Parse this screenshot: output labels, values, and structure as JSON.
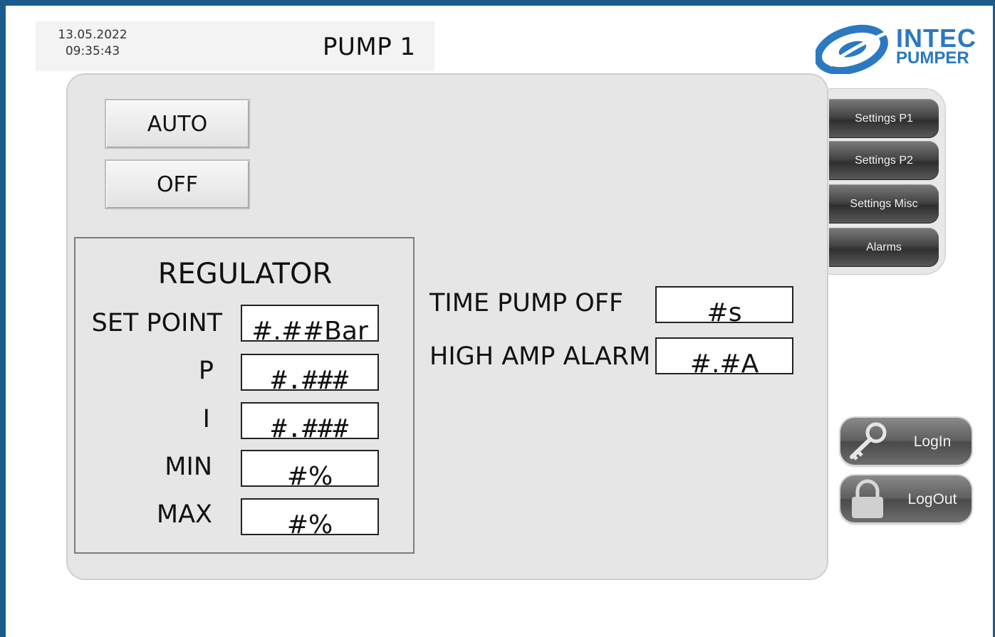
{
  "header": {
    "date": "13.05.2022",
    "time": "09:35:43",
    "title": "PUMP 1",
    "logo_line1": "INTEC",
    "logo_line2": "PUMPER",
    "brand_color": "#2b79c2"
  },
  "mode_buttons": {
    "auto": "AUTO",
    "off": "OFF"
  },
  "regulator": {
    "title": "REGULATOR",
    "rows": [
      {
        "label": "SET POINT",
        "value": "#.##Bar"
      },
      {
        "label": "P",
        "value": "#.###"
      },
      {
        "label": "I",
        "value": "#.###"
      },
      {
        "label": "MIN",
        "value": "#%"
      },
      {
        "label": "MAX",
        "value": "#%"
      }
    ]
  },
  "settings": {
    "time_pump_off": {
      "label": "TIME PUMP OFF",
      "value": "#s"
    },
    "high_amp_alarm": {
      "label": "HIGH AMP ALARM",
      "value": "#.#A"
    }
  },
  "nav": {
    "items": [
      {
        "label": "Settings P1"
      },
      {
        "label": "Settings P2"
      },
      {
        "label": "Settings Misc"
      },
      {
        "label": "Alarms"
      }
    ]
  },
  "auth": {
    "login": "LogIn",
    "logout": "LogOut"
  },
  "icons": {
    "login": "key-icon",
    "logout": "padlock-icon",
    "logo": "intec-swirl-logo"
  },
  "colors": {
    "frame": "#1b5a8f",
    "panel": "#e6e6e6",
    "nav_button": "#454545"
  }
}
